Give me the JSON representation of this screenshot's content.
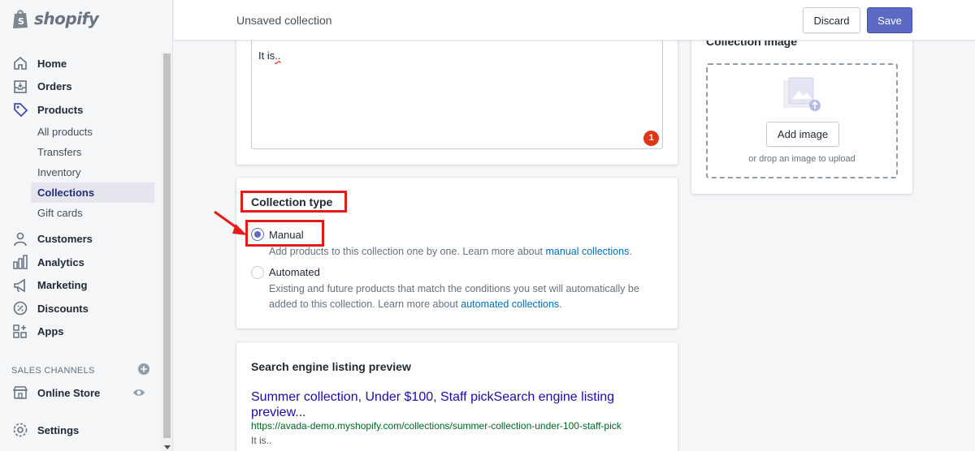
{
  "brand": {
    "name": "shopify"
  },
  "nav": {
    "home": "Home",
    "orders": "Orders",
    "products": "Products",
    "sub": [
      "All products",
      "Transfers",
      "Inventory",
      "Collections",
      "Gift cards"
    ],
    "customers": "Customers",
    "analytics": "Analytics",
    "marketing": "Marketing",
    "discounts": "Discounts",
    "apps": "Apps",
    "sales_channels": "SALES CHANNELS",
    "online_store": "Online Store",
    "settings": "Settings"
  },
  "topbar": {
    "title": "Unsaved collection",
    "discard_label": "Discard",
    "save_label": "Save"
  },
  "editor": {
    "text": "It is",
    "text_tail": "..",
    "error_count": "1"
  },
  "collection_type": {
    "title": "Collection type",
    "manual_label": "Manual",
    "manual_help": "Add products to this collection one by one. Learn more about ",
    "manual_link": "manual collections",
    "manual_help_end": ".",
    "automated_label": "Automated",
    "automated_help": "Existing and future products that match the conditions you set will automatically be added to this collection. Learn more about ",
    "automated_link": "automated collections",
    "automated_help_end": "."
  },
  "seo": {
    "title": "Search engine listing preview",
    "link_text": "Summer collection, Under $100, Staff pickSearch engine listing preview...",
    "url": "https://avada-demo.myshopify.com/collections/summer-collection-under-100-staff-pick",
    "description": "It is.."
  },
  "image_card": {
    "title": "Collection image",
    "add_button": "Add image",
    "hint": "or drop an image to upload"
  },
  "colors": {
    "accent": "#5c6ac4",
    "highlight": "#e21b1b",
    "link": "#006fbb"
  }
}
